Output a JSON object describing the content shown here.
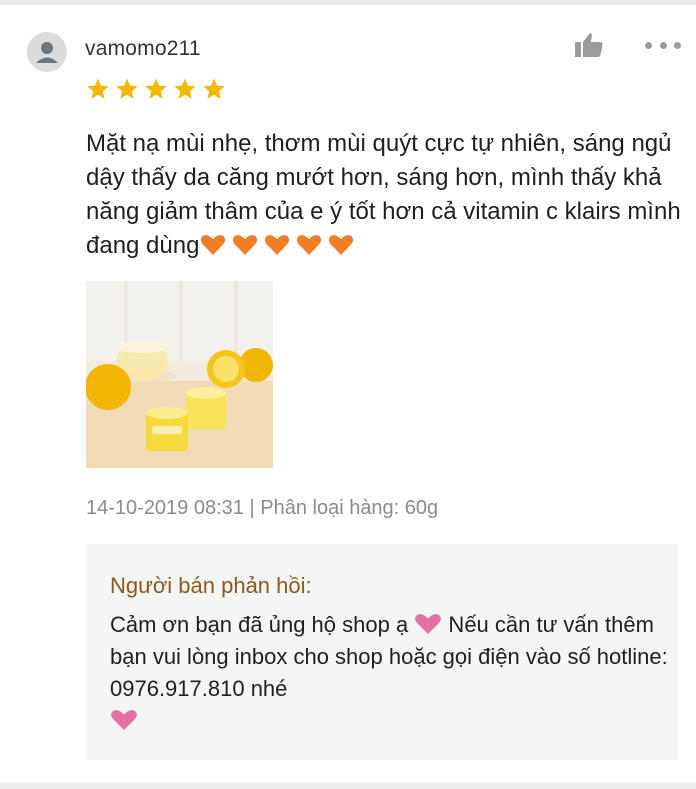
{
  "review": {
    "username": "vamomo211",
    "rating": 5,
    "rating_max": 5,
    "text": "Mặt nạ mùi nhẹ, thơm mùi quýt cực tự nhiên, sáng ngủ dậy thấy da căng mướt hơn, sáng hơn, mình thấy khả năng giảm thâm của e ý tốt hơn cả vitamin c klairs mình đang dùng",
    "heart_count": 5,
    "timestamp": "14-10-2019 08:31",
    "separator": " | ",
    "variation": "Phân loại hàng: 60g"
  },
  "seller_reply": {
    "title": "Người bán phản hồi:",
    "text_part1": "Cảm ơn bạn đã ủng hộ shop ạ ",
    "text_part2": " Nếu cần tư vấn thêm bạn vui lòng inbox cho shop hoặc gọi điện vào số hotline: 0976.917.810 nhé"
  },
  "icons": {
    "avatar": "user-avatar-icon",
    "like": "thumbs-up-icon",
    "more": "more-dots-icon",
    "star": "star-icon",
    "review_heart": "orange-heart-icon",
    "reply_heart": "pink-heart-icon"
  },
  "colors": {
    "star": "#f5b800",
    "orange_heart": "#f07e25",
    "pink_heart": "#e46fa2",
    "reply_title": "#8b5a1e",
    "meta_text": "#8c8c8c",
    "reply_bg": "#f5f5f5"
  }
}
